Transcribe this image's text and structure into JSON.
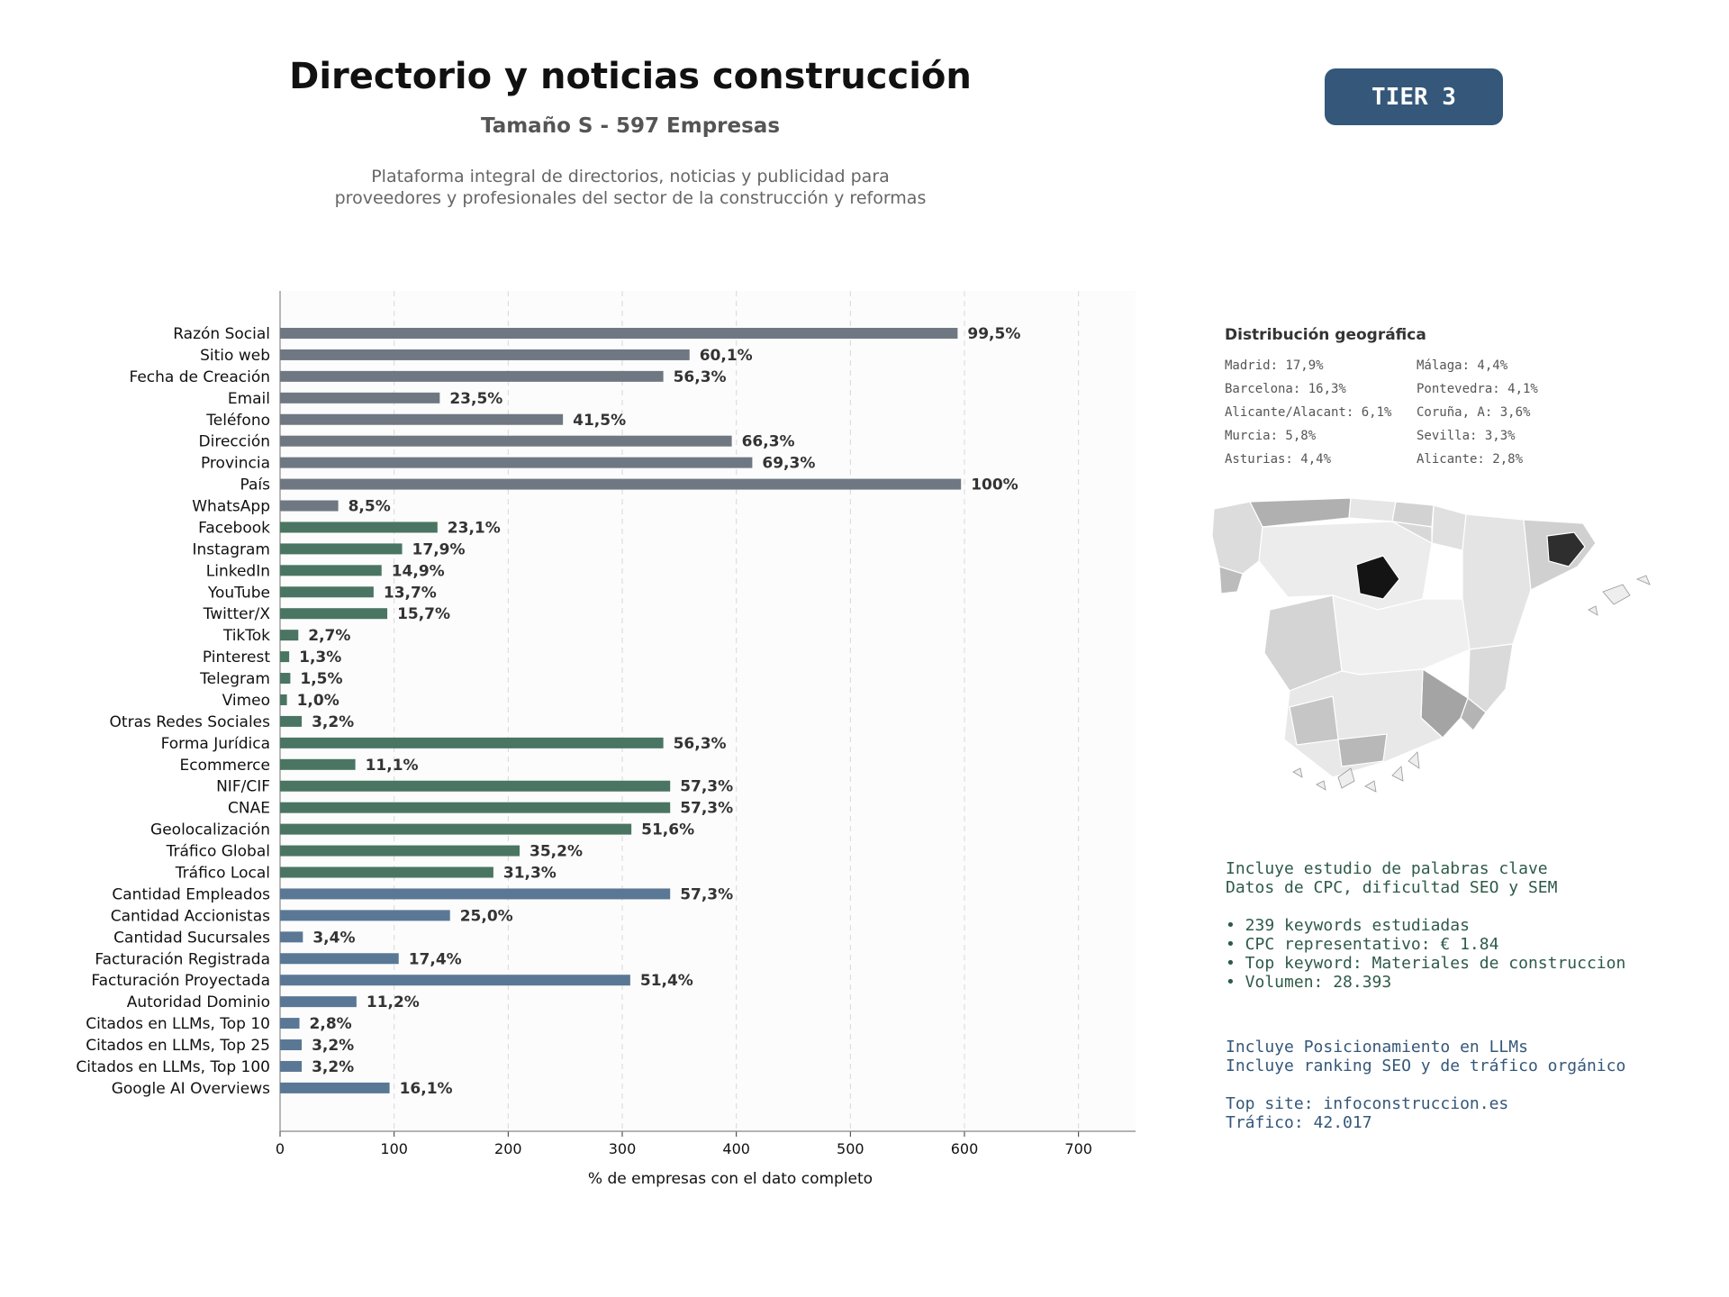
{
  "header": {
    "title": "Directorio y noticias construcción",
    "subtitle": "Tamaño S - 597 Empresas",
    "description_line1": "Plataforma integral de directorios, noticias y publicidad para",
    "description_line2": "proveedores y profesionales del sector de la construcción y reformas",
    "badge": "TIER 3"
  },
  "chart_data": {
    "type": "bar",
    "orientation": "horizontal",
    "xlabel": "% de empresas con el dato completo",
    "xlim": [
      0,
      750
    ],
    "xticks": [
      0,
      100,
      200,
      300,
      400,
      500,
      600,
      700
    ],
    "grid": "vertical dashed",
    "categories": [
      "Razón Social",
      "Sitio web",
      "Fecha de Creación",
      "Email",
      "Teléfono",
      "Dirección",
      "Provincia",
      "País",
      "WhatsApp",
      "Facebook",
      "Instagram",
      "LinkedIn",
      "YouTube",
      "Twitter/X",
      "TikTok",
      "Pinterest",
      "Telegram",
      "Vimeo",
      "Otras Redes Sociales",
      "Forma Jurídica",
      "Ecommerce",
      "NIF/CIF",
      "CNAE",
      "Geolocalización",
      "Tráfico Global",
      "Tráfico Local",
      "Cantidad Empleados",
      "Cantidad Accionistas",
      "Cantidad Sucursales",
      "Facturación Registrada",
      "Facturación Proyectada",
      "Autoridad Dominio",
      "Citados en LLMs, Top 10",
      "Citados en LLMs, Top 25",
      "Citados en LLMs, Top 100",
      "Google AI Overviews"
    ],
    "values": [
      594,
      359,
      336,
      140,
      248,
      396,
      414,
      597,
      51,
      138,
      107,
      89,
      82,
      94,
      16,
      8,
      9,
      6,
      19,
      336,
      66,
      342,
      342,
      308,
      210,
      187,
      342,
      149,
      20,
      104,
      307,
      67,
      17,
      19,
      19,
      96
    ],
    "labels": [
      "99,5%",
      "60,1%",
      "56,3%",
      "23,5%",
      "41,5%",
      "66,3%",
      "69,3%",
      "100%",
      "8,5%",
      "23,1%",
      "17,9%",
      "14,9%",
      "13,7%",
      "15,7%",
      "2,7%",
      "1,3%",
      "1,5%",
      "1,0%",
      "3,2%",
      "56,3%",
      "11,1%",
      "57,3%",
      "57,3%",
      "51,6%",
      "35,2%",
      "31,3%",
      "57,3%",
      "25,0%",
      "3,4%",
      "17,4%",
      "51,4%",
      "11,2%",
      "2,8%",
      "3,2%",
      "3,2%",
      "16,1%"
    ],
    "groups": [
      9,
      17,
      10
    ],
    "colors": [
      "#6f7882",
      "#4a7562",
      "#5a7895"
    ]
  },
  "geo": {
    "title": "Distribución geográfica",
    "left": [
      "Madrid: 17,9%",
      "Barcelona: 16,3%",
      "Alicante/Alacant: 6,1%",
      "Murcia: 5,8%",
      "Asturias: 4,4%"
    ],
    "right": [
      "Málaga: 4,4%",
      "Pontevedra: 4,1%",
      "Coruña, A: 3,6%",
      "Sevilla: 3,3%",
      "Alicante: 2,8%"
    ]
  },
  "info": {
    "block1": "Incluye estudio de palabras clave\nDatos de CPC, dificultad SEO y SEM\n\n• 239 keywords estudiadas\n• CPC representativo: € 1.84\n• Top keyword: Materiales de construccion\n• Volumen: 28.393",
    "block2": "Incluye Posicionamiento en LLMs\nIncluye ranking SEO y de tráfico orgánico\n\nTop site: infoconstruccion.es\nTráfico: 42.017"
  }
}
